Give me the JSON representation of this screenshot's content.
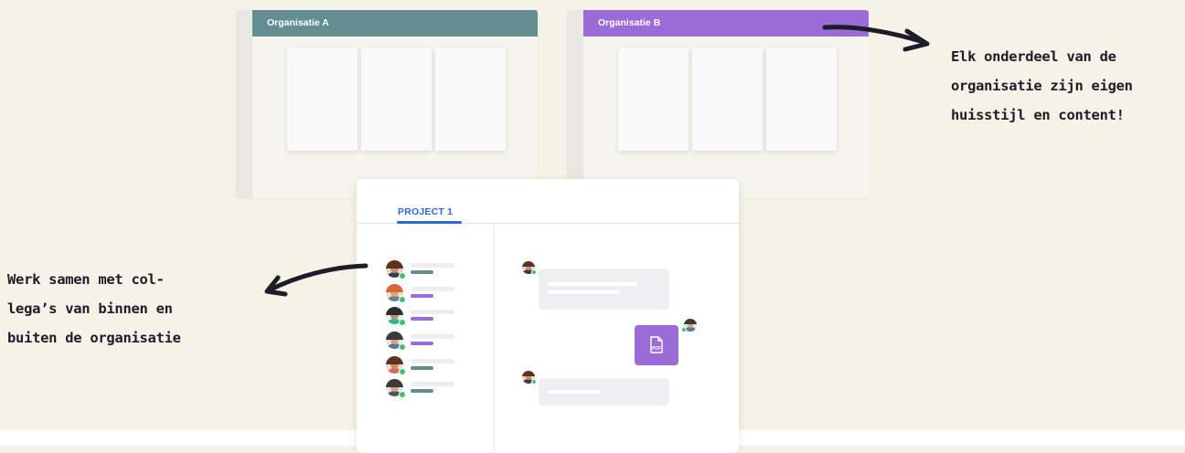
{
  "organisations": [
    {
      "name": "Organisatie A",
      "color": "#638d90"
    },
    {
      "name": "Organisatie B",
      "color": "#9b6bd7"
    }
  ],
  "project": {
    "tab_label": "PROJECT 1",
    "accent": "#2c69d6",
    "attachment": {
      "type": "PDF",
      "icon": "pdf-file-icon"
    }
  },
  "annotations": {
    "right": [
      "Elk onderdeel van de",
      "organisatie zijn eigen",
      "huisstijl en content!"
    ],
    "left": [
      "Werk samen met col-",
      "lega’s van binnen en",
      "buiten de organisatie"
    ]
  },
  "colors": {
    "background": "#f5f2e7",
    "teal": "#638d90",
    "purple": "#9b6bd7",
    "online": "#3fc26f"
  }
}
